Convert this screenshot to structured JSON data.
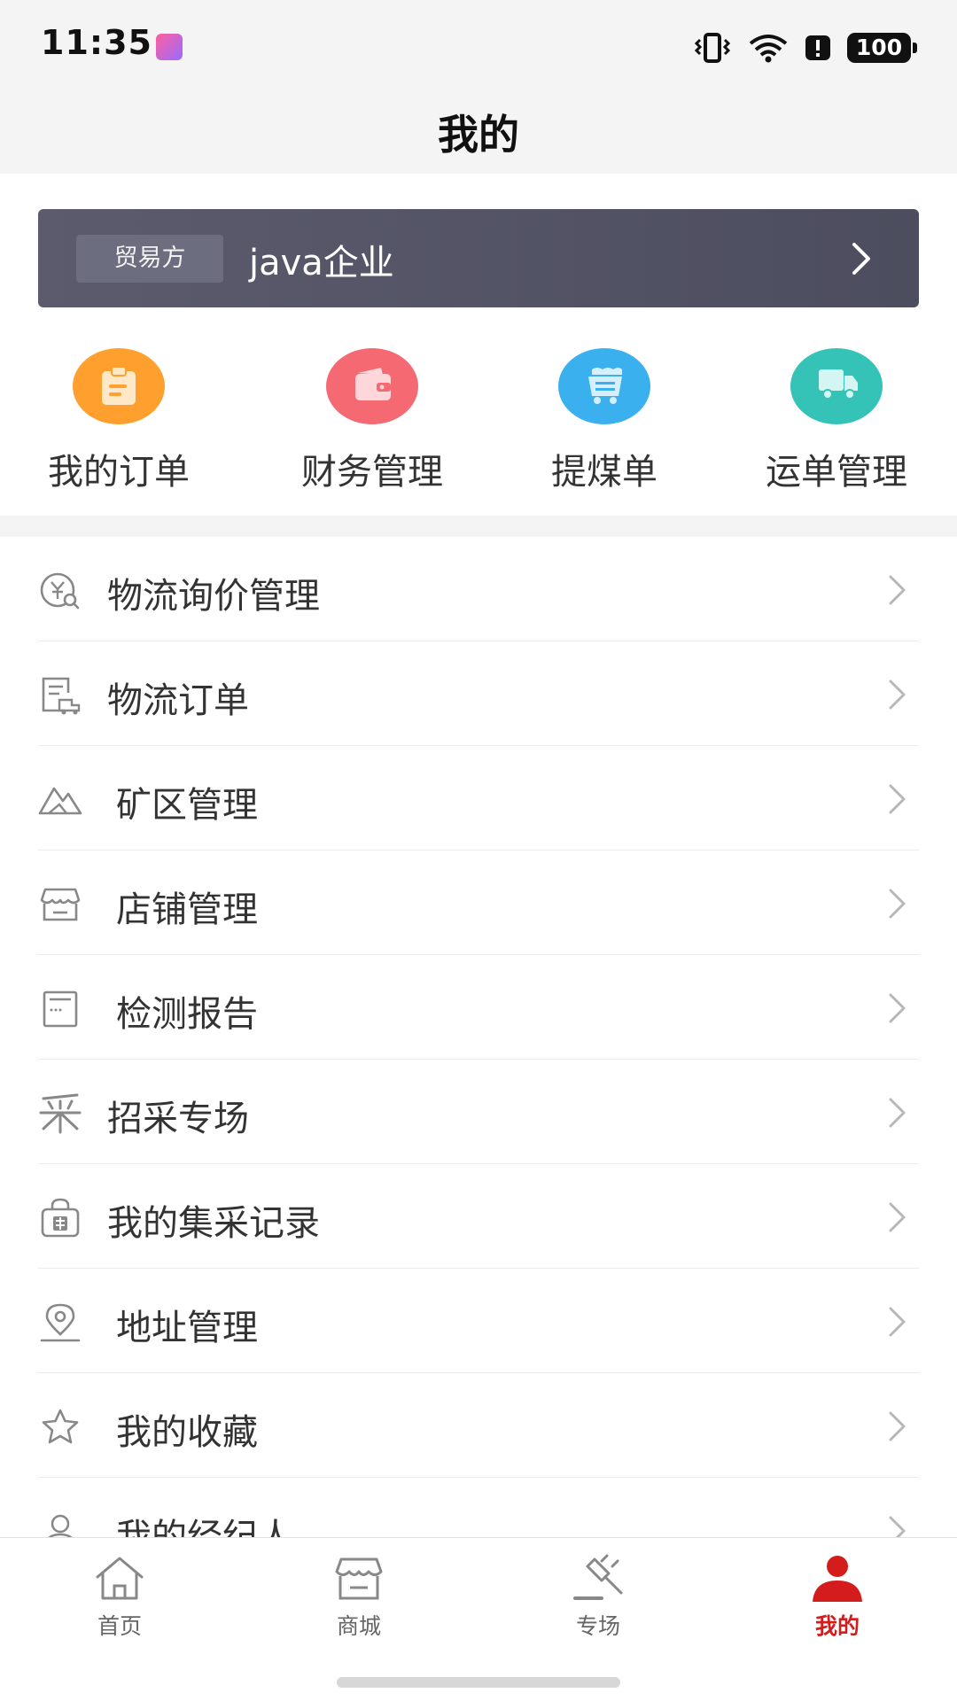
{
  "status_bar": {
    "time": "11:35",
    "battery": "100"
  },
  "header": {
    "title": "我的"
  },
  "company_card": {
    "role_tag": "贸易方",
    "company_name": "java企业"
  },
  "quick_entries": [
    {
      "label": "我的订单",
      "icon": "clipboard-icon",
      "color": "#ff9f2e"
    },
    {
      "label": "财务管理",
      "icon": "wallet-icon",
      "color": "#f56a72"
    },
    {
      "label": "提煤单",
      "icon": "coal-cart-icon",
      "color": "#3bb0ee"
    },
    {
      "label": "运单管理",
      "icon": "truck-icon",
      "color": "#34c3b6"
    }
  ],
  "menu": [
    {
      "label": "物流询价管理",
      "icon": "yen-search-icon"
    },
    {
      "label": "物流订单",
      "icon": "logistics-order-icon"
    },
    {
      "label": "矿区管理",
      "icon": "mountain-icon"
    },
    {
      "label": "店铺管理",
      "icon": "store-icon"
    },
    {
      "label": "检测报告",
      "icon": "report-icon"
    },
    {
      "label": "招采专场",
      "icon": "procurement-icon"
    },
    {
      "label": "我的集采记录",
      "icon": "group-buy-bag-icon"
    },
    {
      "label": "地址管理",
      "icon": "location-pin-icon"
    },
    {
      "label": "我的收藏",
      "icon": "star-icon"
    },
    {
      "label": "我的经纪人",
      "icon": "person-icon"
    }
  ],
  "tab_bar": [
    {
      "label": "首页",
      "icon": "home-icon"
    },
    {
      "label": "商城",
      "icon": "shop-icon"
    },
    {
      "label": "专场",
      "icon": "auction-hammer-icon"
    },
    {
      "label": "我的",
      "icon": "user-icon",
      "active": true
    }
  ],
  "colors": {
    "accent": "#d41c1c",
    "card_background": "#535465"
  }
}
